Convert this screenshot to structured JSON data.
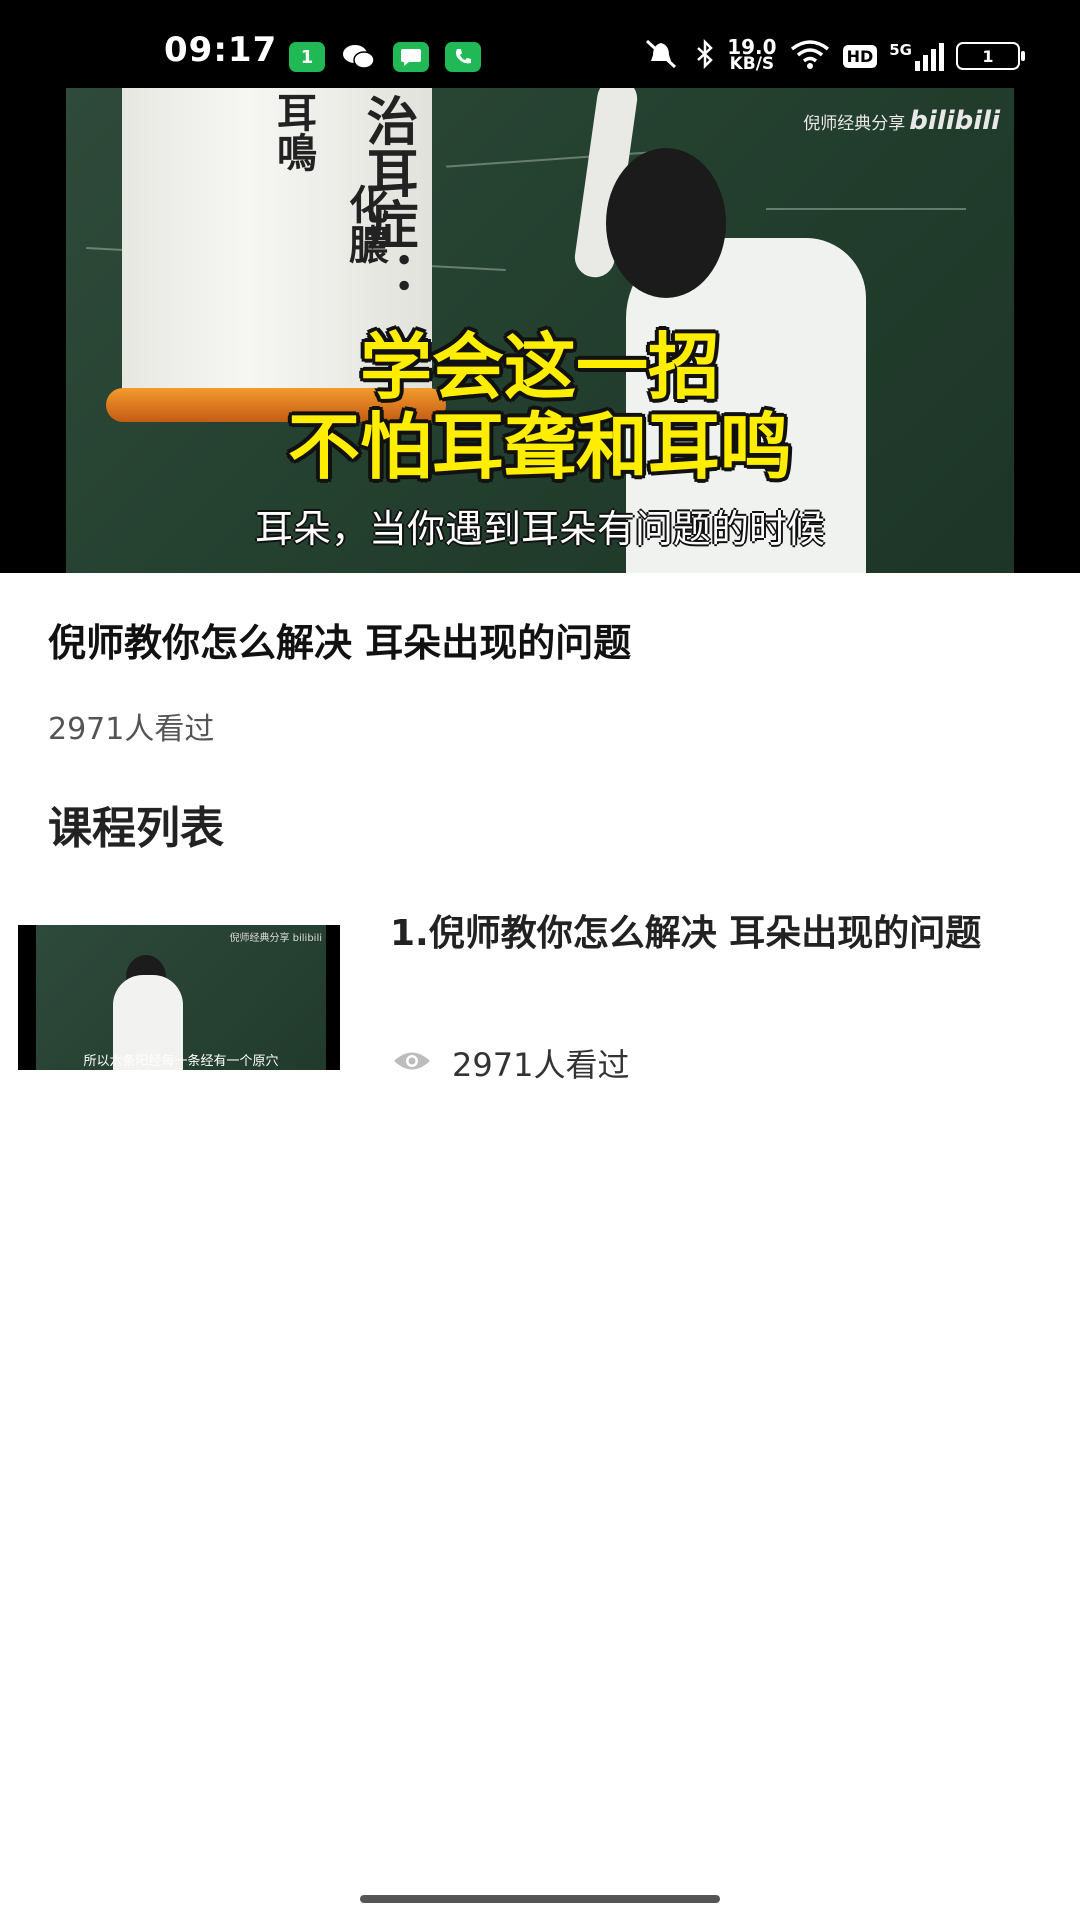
{
  "status_bar": {
    "time": "09:17",
    "app_icons": [
      "tiktok-icon",
      "wechat-icon",
      "messages-icon",
      "phone-icon"
    ],
    "app_badge": "1",
    "net_speed_value": "19.0",
    "net_speed_unit": "KB/S",
    "hd_label": "HD",
    "network_label": "5G",
    "battery_level": "1"
  },
  "video": {
    "watermark_text": "倪师经典分享",
    "watermark_brand": "bilibili",
    "scroll_text_1": "耳鳴",
    "scroll_text_2": "化膿",
    "scroll_text_3": "治耳症：",
    "caption_line_1": "学会这一招",
    "caption_line_2": "不怕耳聋和耳鸣",
    "subtitle": "耳朵，当你遇到耳朵有问题的时候"
  },
  "course": {
    "title": "倪师教你怎么解决 耳朵出现的问题",
    "views": "2971人看过"
  },
  "section": {
    "title": "课程列表"
  },
  "lessons": [
    {
      "title": "1.倪师教你怎么解决 耳朵出现的问题",
      "views": "2971人看过",
      "thumb_subtitle": "所以六条阳经每一条经有一个原穴",
      "thumb_watermark": "倪师经典分享 bilibili"
    }
  ],
  "colors": {
    "status_bar_bg": "#000000",
    "app_icon_green": "#21b856",
    "caption_yellow": "#ffee00",
    "text_primary": "#111111",
    "text_secondary": "#555555"
  }
}
